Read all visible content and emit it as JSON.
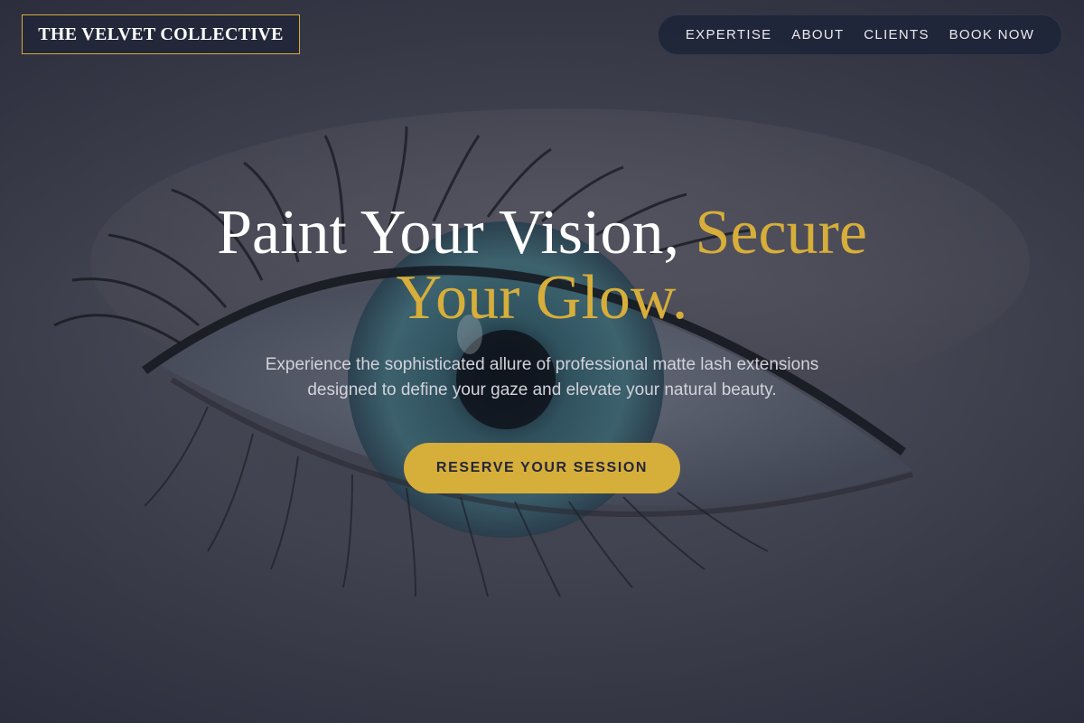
{
  "brand": {
    "name": "THE VELVET COLLECTIVE",
    "border_color": "#d4ae3c"
  },
  "nav": {
    "items": [
      {
        "label": "EXPERTISE"
      },
      {
        "label": "ABOUT"
      },
      {
        "label": "CLIENTS"
      },
      {
        "label": "BOOK NOW"
      }
    ]
  },
  "hero": {
    "headline_part1": "Paint Your Vision, ",
    "headline_accent": "Secure Your Glow.",
    "subtitle": "Experience the sophisticated allure of professional matte lash extensions designed to define your gaze and elevate your natural beauty.",
    "cta_label": "RESERVE YOUR SESSION",
    "background_image": "close-up-eye-photo"
  },
  "colors": {
    "accent_gold": "#d7ae3a",
    "nav_bg": "#1e2438",
    "text_white": "#ffffff"
  }
}
